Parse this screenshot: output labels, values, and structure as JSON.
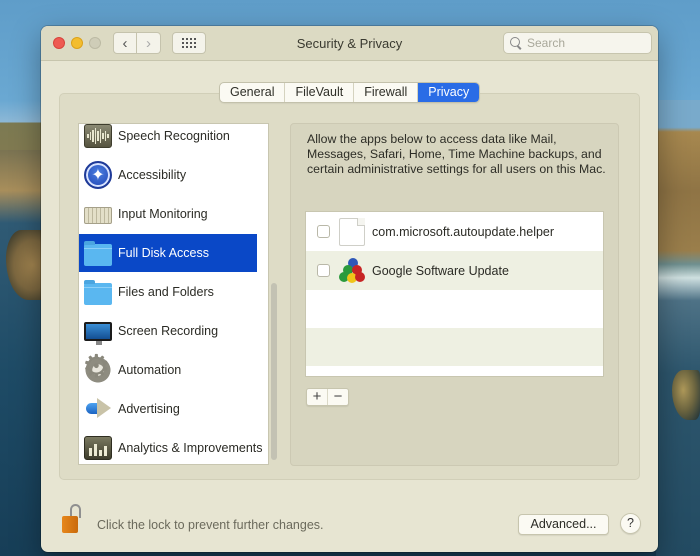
{
  "window": {
    "title": "Security & Privacy"
  },
  "toolbar": {
    "back_icon": "chevron-left-icon",
    "forward_icon": "chevron-right-icon",
    "show_all_icon": "grid-icon",
    "back_glyph": "‹",
    "forward_glyph": "›",
    "search_placeholder": "Search",
    "search_value": ""
  },
  "tabs": [
    {
      "label": "General",
      "active": false
    },
    {
      "label": "FileVault",
      "active": false
    },
    {
      "label": "Firewall",
      "active": false
    },
    {
      "label": "Privacy",
      "active": true
    }
  ],
  "sidebar": {
    "items": [
      {
        "label": "Speech Recognition",
        "icon": "speech-recognition-icon",
        "selected": false
      },
      {
        "label": "Accessibility",
        "icon": "accessibility-icon",
        "selected": false
      },
      {
        "label": "Input Monitoring",
        "icon": "keyboard-icon",
        "selected": false
      },
      {
        "label": "Full Disk Access",
        "icon": "folder-icon",
        "selected": true
      },
      {
        "label": "Files and Folders",
        "icon": "folder-icon",
        "selected": false
      },
      {
        "label": "Screen Recording",
        "icon": "monitor-icon",
        "selected": false
      },
      {
        "label": "Automation",
        "icon": "gear-icon",
        "selected": false
      },
      {
        "label": "Advertising",
        "icon": "megaphone-icon",
        "selected": false
      },
      {
        "label": "Analytics & Improvements",
        "icon": "analytics-icon",
        "selected": false
      }
    ]
  },
  "main": {
    "description": "Allow the apps below to access data like Mail, Messages, Safari, Home, Time Machine backups, and certain administrative settings for all users on this Mac.",
    "apps": [
      {
        "name": "com.microsoft.autoupdate.helper",
        "checked": false,
        "icon": "document-icon"
      },
      {
        "name": "Google Software Update",
        "checked": false,
        "icon": "google-software-update-icon"
      }
    ],
    "add_label": "+",
    "remove_label": "−"
  },
  "footer": {
    "lock_text": "Click the lock to prevent further changes.",
    "advanced_label": "Advanced...",
    "help_label": "?"
  },
  "colors": {
    "accent": "#2a6ce6",
    "selection": "#0a48c7",
    "close": "#ee5a52",
    "minimize": "#f3bd2f"
  }
}
